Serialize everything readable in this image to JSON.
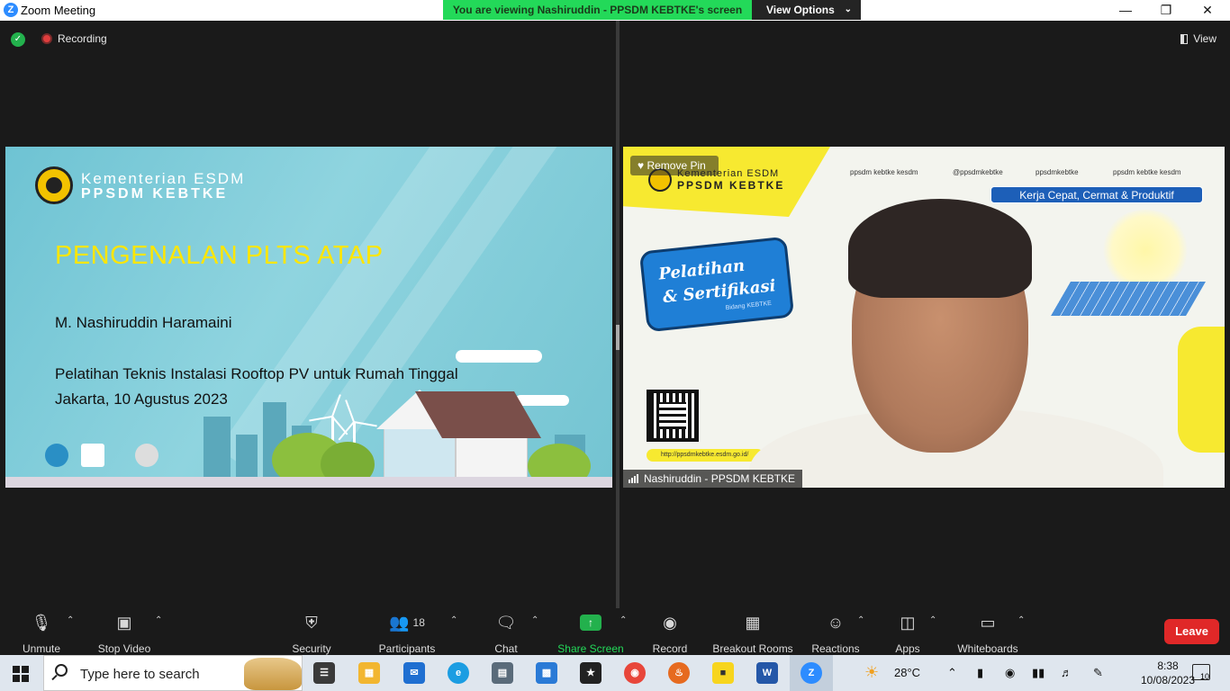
{
  "window": {
    "title": "Zoom Meeting",
    "viewing_banner": "You are viewing Nashiruddin - PPSDM KEBTKE's screen",
    "view_options": "View Options",
    "minimize": "—",
    "restore": "❐",
    "close": "✕"
  },
  "meeting": {
    "recording_label": "Recording",
    "view_label": "View"
  },
  "slide": {
    "org_line1": "Kementerian ESDM",
    "org_line2": "PPSDM KEBTKE",
    "title": "PENGENALAN PLTS ATAP",
    "author": "M. Nashiruddin Haramaini",
    "course": "Pelatihan Teknis Instalasi Rooftop PV untuk Rumah Tinggal",
    "date": "Jakarta, 10 Agustus 2023"
  },
  "video": {
    "remove_pin": "Remove Pin",
    "org_line1": "Kementerian ESDM",
    "org_line2": "PPSDM KEBTKE",
    "social_1": "ppsdm kebtke kesdm",
    "social_2": "@ppsdmkebtke",
    "social_3": "ppsdmkebtke",
    "social_4": "ppsdm kebtke kesdm",
    "tagline": "Kerja Cepat, Cermat & Produktif",
    "bubble_line1": "Pelatihan",
    "bubble_line2": "& Sertifikasi",
    "bubble_line3": "Bidang KEBTKE",
    "url": "http://ppsdmkebtke.esdm.go.id/",
    "participant_name": "Nashiruddin - PPSDM KEBTKE"
  },
  "toolbar": {
    "unmute": "Unmute",
    "stop_video": "Stop Video",
    "security": "Security",
    "participants": "Participants",
    "participants_count": "18",
    "chat": "Chat",
    "share_screen": "Share Screen",
    "record": "Record",
    "breakout_rooms": "Breakout Rooms",
    "reactions": "Reactions",
    "apps": "Apps",
    "whiteboards": "Whiteboards",
    "leave": "Leave"
  },
  "taskbar": {
    "search_placeholder": "Type here to search",
    "weather": "28°C",
    "time": "8:38",
    "date": "10/08/2023",
    "notifications": "10"
  }
}
